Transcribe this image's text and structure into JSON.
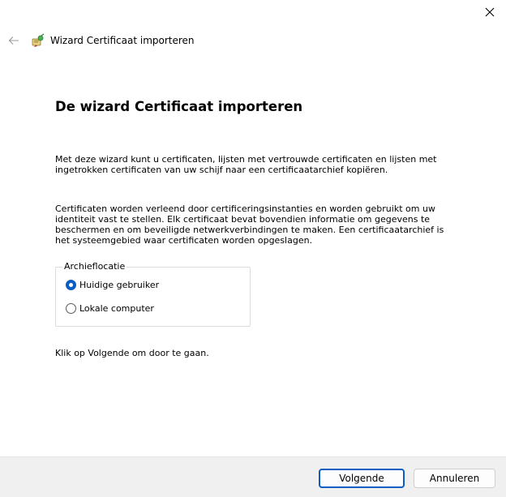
{
  "header": {
    "title": "Wizard Certificaat importeren",
    "back_icon": "back-arrow-icon",
    "app_icon": "certificate-wizard-icon",
    "close_icon": "close-icon"
  },
  "main": {
    "title": "De wizard Certificaat importeren",
    "paragraph1": "Met deze wizard kunt u certificaten, lijsten met vertrouwde certificaten en lijsten met ingetrokken certificaten van uw schijf naar een certificaatarchief kopiëren.",
    "paragraph2": "Certificaten worden verleend door certificeringsinstanties en worden gebruikt om uw identiteit vast te stellen. Elk certificaat bevat bovendien informatie om gegevens te beschermen en om beveiligde netwerkverbindingen te maken. Een certificaatarchief is het systeemgebied waar certificaten worden opgeslagen.",
    "store_location": {
      "legend": "Archieflocatie",
      "options": [
        {
          "label": "Huidige gebruiker",
          "selected": true
        },
        {
          "label": "Lokale computer",
          "selected": false
        }
      ]
    },
    "paragraph3": "Klik op Volgende om door te gaan."
  },
  "footer": {
    "next_label": "Volgende",
    "cancel_label": "Annuleren"
  },
  "colors": {
    "accent": "#0a5dc2",
    "footer_bg": "#f0f0f0"
  }
}
